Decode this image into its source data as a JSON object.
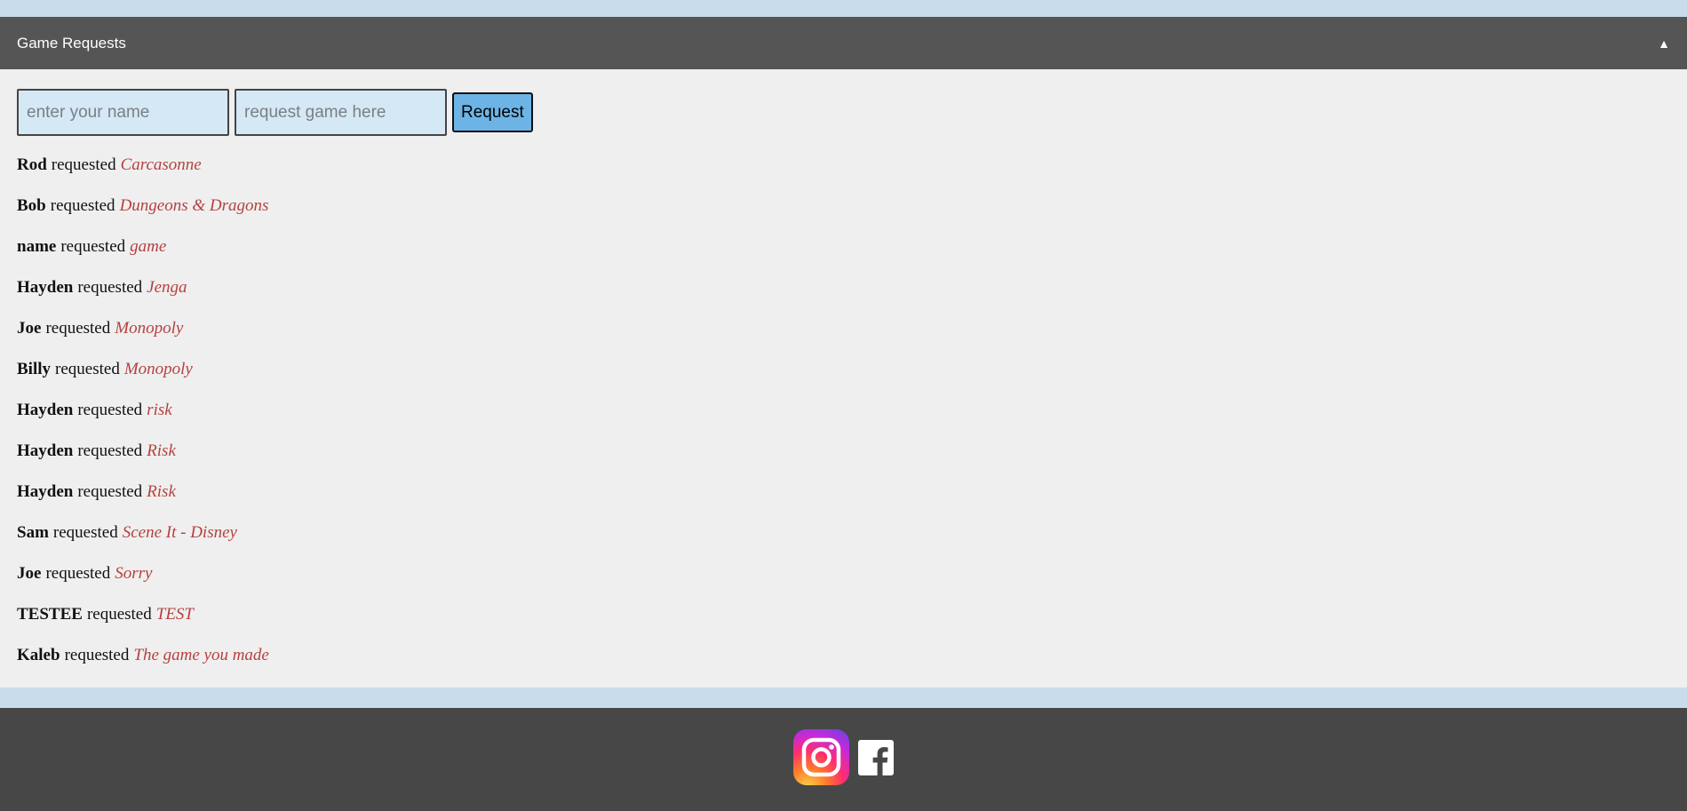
{
  "panel": {
    "title": "Game Requests",
    "toggle_glyph": "▲"
  },
  "form": {
    "name_placeholder": "enter your name",
    "game_placeholder": "request game here",
    "submit_label": "Request"
  },
  "requests": [
    {
      "name": "Rod",
      "verb": "requested",
      "game": "Carcasonne"
    },
    {
      "name": "Bob",
      "verb": "requested",
      "game": "Dungeons & Dragons"
    },
    {
      "name": "name",
      "verb": "requested",
      "game": "game"
    },
    {
      "name": "Hayden",
      "verb": "requested",
      "game": "Jenga"
    },
    {
      "name": "Joe",
      "verb": "requested",
      "game": "Monopoly"
    },
    {
      "name": "Billy",
      "verb": "requested",
      "game": "Monopoly"
    },
    {
      "name": "Hayden",
      "verb": "requested",
      "game": "risk"
    },
    {
      "name": "Hayden",
      "verb": "requested",
      "game": "Risk"
    },
    {
      "name": "Hayden",
      "verb": "requested",
      "game": "Risk"
    },
    {
      "name": "Sam",
      "verb": "requested",
      "game": "Scene It - Disney"
    },
    {
      "name": "Joe",
      "verb": "requested",
      "game": "Sorry"
    },
    {
      "name": "TESTEE",
      "verb": "requested",
      "game": "TEST"
    },
    {
      "name": "Kaleb",
      "verb": "requested",
      "game": "The game you made"
    }
  ],
  "footer": {
    "icons": [
      "instagram-icon",
      "facebook-icon"
    ]
  },
  "colors": {
    "header_bg": "#555555",
    "body_bg": "#efefef",
    "page_bg": "#c9dceb",
    "footer_bg": "#474747",
    "game_text": "#b5413f",
    "button_bg": "#6db4e6",
    "input_bg": "#d5e8f6"
  }
}
